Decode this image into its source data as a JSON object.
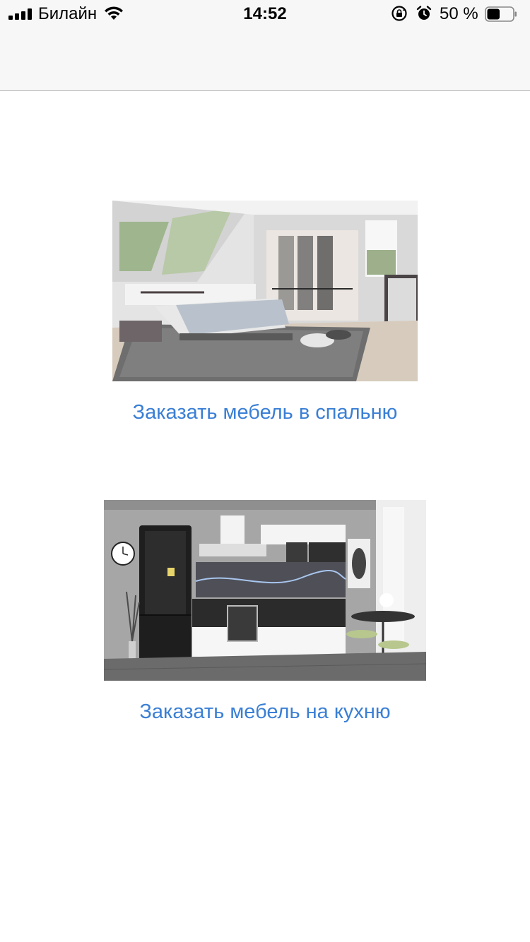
{
  "status_bar": {
    "carrier": "Билайн",
    "time": "14:52",
    "battery_percent": "50 %",
    "signal_bars": 4,
    "battery_level": 0.5
  },
  "items": [
    {
      "link_text": "Заказать мебель в спальню",
      "image": "bedroom-photo"
    },
    {
      "link_text": "Заказать мебель на кухню",
      "image": "kitchen-photo"
    }
  ],
  "colors": {
    "link": "#3a7fd5",
    "bar_bg": "#f7f7f7"
  }
}
